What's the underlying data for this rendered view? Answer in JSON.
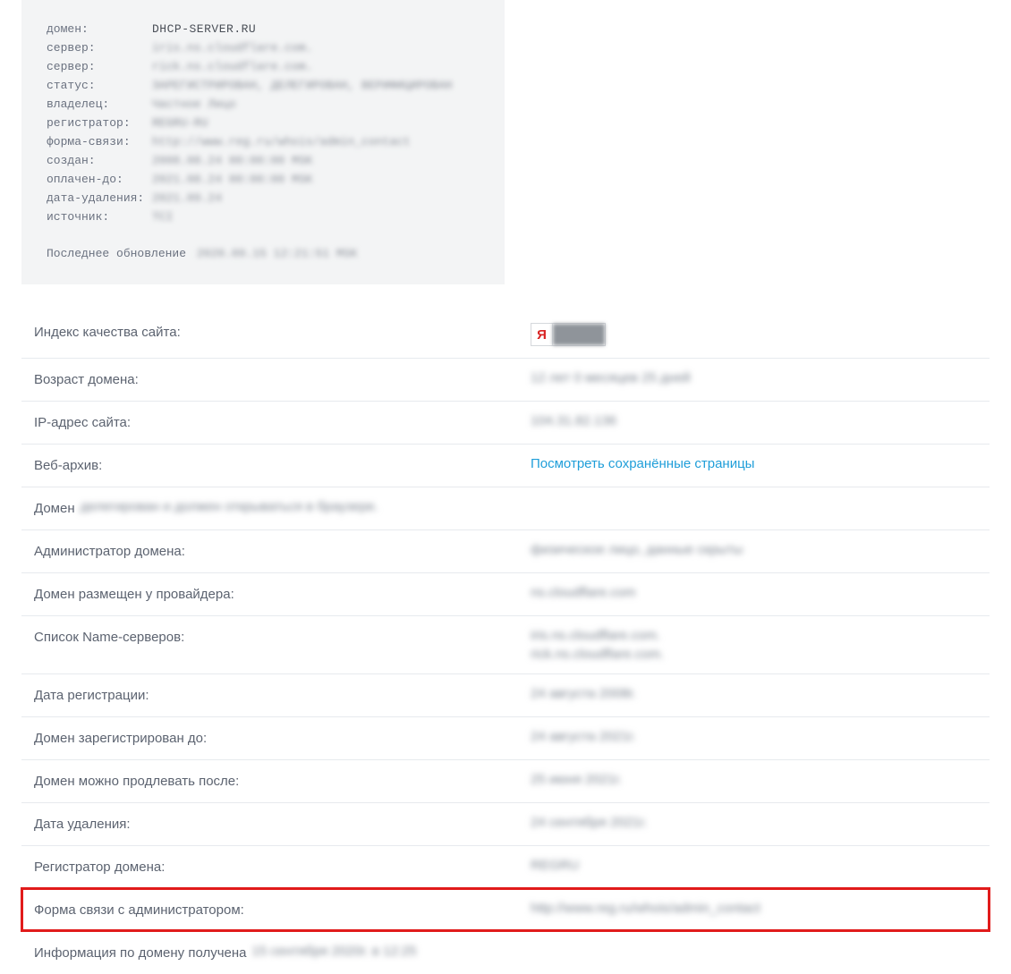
{
  "whois": {
    "domain_key": "домен:",
    "domain_val": "DHCP-SERVER.RU",
    "rows": [
      {
        "key": "сервер:",
        "val": "iris.ns.cloudflare.com."
      },
      {
        "key": "сервер:",
        "val": "rick.ns.cloudflare.com."
      },
      {
        "key": "статус:",
        "val": "ЗАРЕГИСТРИРОВАН, ДЕЛЕГИРОВАН, ВЕРИФИЦИРОВАН"
      },
      {
        "key": "владелец:",
        "val": "Частное Лицо"
      },
      {
        "key": "регистратор:",
        "val": "REGRU-RU"
      },
      {
        "key": "форма-связи:",
        "val": "http://www.reg.ru/whois/admin_contact"
      },
      {
        "key": "создан:",
        "val": "2008.08.24 00:00:00 MSK"
      },
      {
        "key": "оплачен-до:",
        "val": "2021.08.24 00:00:00 MSK"
      },
      {
        "key": "дата-удаления:",
        "val": "2021.09.24"
      },
      {
        "key": "источник:",
        "val": "TCI"
      }
    ],
    "footer_label": "Последнее обновление",
    "footer_value": "2020.09.15 12:21:51 MSK"
  },
  "info_rows": [
    {
      "label": "Индекс качества сайта:",
      "type": "yandex"
    },
    {
      "label": "Возраст домена:",
      "value": "12 лет 0 месяцев 25 дней",
      "blur": true
    },
    {
      "label": "IP-адрес сайта:",
      "value": "104.31.82.136",
      "blur": true,
      "link": true
    },
    {
      "label": "Веб-архив:",
      "value": "Посмотреть сохранённые страницы",
      "link": true
    },
    {
      "label": "Домен",
      "value": "делегирован и должен открываться в браузере.",
      "blur": true,
      "full": true
    },
    {
      "label": "Администратор домена:",
      "value": "физическое лицо, данные скрыты",
      "blur": true
    },
    {
      "label": "Домен размещен у провайдера:",
      "value": "ns.cloudflare.com",
      "blur": true
    },
    {
      "label": "Список Name-серверов:",
      "value": [
        "iris.ns.cloudflare.com.",
        "rick.ns.cloudflare.com."
      ],
      "blur": true,
      "multi": true
    },
    {
      "label": "Дата регистрации:",
      "value": "24 августа 2008г.",
      "blur": true
    },
    {
      "label": "Домен зарегистрирован до:",
      "value": "24 августа 2021г.",
      "blur": true
    },
    {
      "label": "Домен можно продлевать после:",
      "value": "25 июня 2021г.",
      "blur": true
    },
    {
      "label": "Дата удаления:",
      "value": "24 сентября 2021г.",
      "blur": true
    },
    {
      "label": "Регистратор домена:",
      "value": "REGRU",
      "blur": true
    },
    {
      "label": "Форма связи с администратором:",
      "value": "http://www.reg.ru/whois/admin_contact",
      "blur": true,
      "highlight": true
    },
    {
      "label": "Информация по домену получена",
      "value": "15 сентября 2020г. в 12:25",
      "blur": true,
      "full": true
    }
  ],
  "yandex_letter": "Я"
}
